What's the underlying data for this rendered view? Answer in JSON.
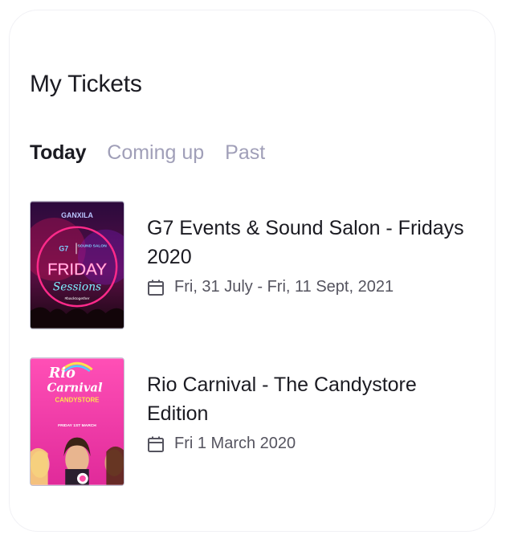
{
  "page": {
    "title": "My Tickets"
  },
  "tabs": [
    {
      "label": "Today",
      "active": true
    },
    {
      "label": "Coming up",
      "active": false
    },
    {
      "label": "Past",
      "active": false
    }
  ],
  "tickets": [
    {
      "name": "G7 Events & Sound Salon - Fridays 2020",
      "date": "Fri, 31 July - Fri, 11 Sept, 2021",
      "poster": {
        "top_text": "GANXILA",
        "brand_left": "G7",
        "brand_right": "SOUND SALON",
        "headline": "FRIDAY",
        "script": "Sessions",
        "hashtag": "#backtogether"
      }
    },
    {
      "name": "Rio Carnival - The Candystore Edition",
      "date": "Fri 1 March 2020",
      "poster": {
        "headline_1": "Rio",
        "headline_2": "Carnival",
        "subtitle": "CANDYSTORE",
        "date_line": "FRIDAY 1ST MARCH"
      }
    }
  ],
  "icons": {
    "date": "calendar-icon"
  },
  "colors": {
    "text": "#1b1b22",
    "muted_tab": "#a09fb8",
    "date_text": "#55545f"
  }
}
